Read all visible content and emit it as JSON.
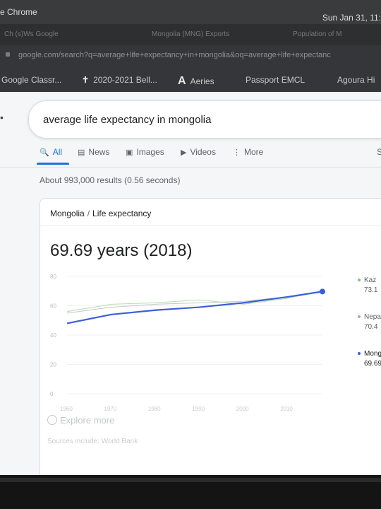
{
  "os": {
    "app_name": "e Chrome",
    "clock": "Sun Jan 31, 11:"
  },
  "tabs": [
    {
      "label": "Ch  (s)Ws Google"
    },
    {
      "label": "Mongolia (MNG) Exports"
    },
    {
      "label": "Population of M"
    }
  ],
  "url": "google.com/search?q=average+life+expectancy+in+mongolia&oq=average+life+expectanc",
  "bookmarks": [
    {
      "icon": "G",
      "label": "Google Classr..."
    },
    {
      "icon": "✝",
      "label": "2020-2021 Bell..."
    },
    {
      "icon": "A",
      "label": "Aeries"
    },
    {
      "icon": "",
      "label": "Passport EMCL"
    },
    {
      "icon": "",
      "label": "Agoura Hi"
    }
  ],
  "search": {
    "query": "average life expectancy in mongolia"
  },
  "nav": [
    {
      "icon": "search-icon",
      "glyph": "🔍",
      "label": "All",
      "active": true
    },
    {
      "icon": "news-icon",
      "glyph": "▤",
      "label": "News"
    },
    {
      "icon": "image-icon",
      "glyph": "▣",
      "label": "Images"
    },
    {
      "icon": "video-icon",
      "glyph": "▶",
      "label": "Videos"
    },
    {
      "icon": "more-icon",
      "glyph": "⋮",
      "label": "More"
    }
  ],
  "settings_label": "S",
  "results_text": "About 993,000 results (0.56 seconds)",
  "card": {
    "crumb_country": "Mongolia",
    "crumb_separator": "/",
    "crumb_topic": "Life expectancy",
    "headline": "69.69 years (2018)",
    "explore_label": "Explore more",
    "sources": "Sources include: World Bank"
  },
  "chart_data": {
    "type": "line",
    "x": [
      1960,
      1970,
      1980,
      1990,
      2000,
      2010,
      2018
    ],
    "y_ticks": [
      "80",
      "60",
      "40",
      "20",
      "0"
    ],
    "x_ticks": [
      "1960",
      "1970",
      "1980",
      "1990",
      "2000",
      "2010"
    ],
    "ylim": [
      0,
      80
    ],
    "series": [
      {
        "name": "Kaz",
        "value_label": "73.1",
        "color": "#b6dcae",
        "values": [
          56,
          61,
          62,
          64,
          61,
          65,
          70
        ]
      },
      {
        "name": "Nepa",
        "value_label": "70.4",
        "color": "#c7c7c7",
        "values": [
          55,
          59,
          61,
          62,
          63,
          66,
          70
        ]
      },
      {
        "name": "Mong",
        "value_label": "69.69",
        "color": "#3b5fd9",
        "values": [
          48,
          54,
          57,
          59,
          62,
          66,
          69.69
        ]
      }
    ]
  }
}
